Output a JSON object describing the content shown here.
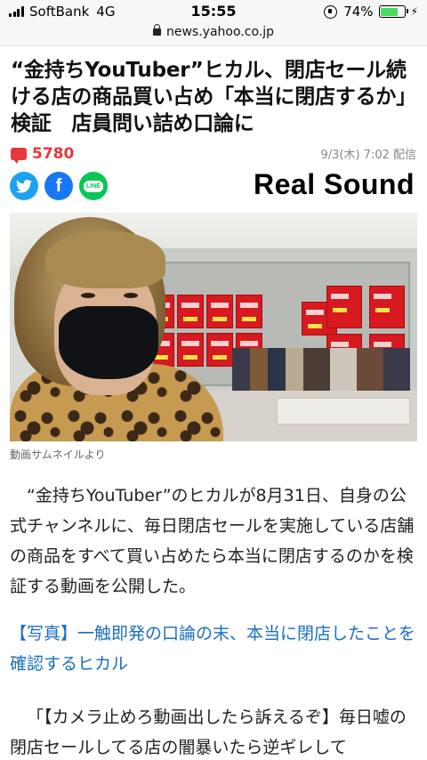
{
  "status_bar": {
    "carrier": "SoftBank",
    "network": "4G",
    "time": "15:55",
    "battery": "74%",
    "battery_level": 0.74
  },
  "url_bar": {
    "url": "news.yahoo.co.jp"
  },
  "article": {
    "headline": "“金持ちYouTuber”ヒカル、閉店セール続ける店の商品買い占め「本当に閉店するか」検証　店員問い詰め口論に",
    "comment_count": "5780",
    "date": "9/3(木) 7:02 配信",
    "publisher": "Real Sound",
    "share": {
      "twitter_icon": "twitter-icon",
      "facebook_icon": "facebook-icon",
      "line_label": "LINE"
    },
    "image_caption": "動画サムネイルより",
    "paragraph_1": "“金持ちYouTuber”のヒカルが8月31日、自身の公式チャンネルに、毎日閉店セールを実施している店舗の商品をすべて買い占めたら本当に閉店するのかを検証する動画を公開した。",
    "photo_link": "【写真】一触即発の口論の末、本当に閉店したことを確認するヒカル",
    "paragraph_2": "「【カメラ止めろ動画出したら訴えるぞ】毎日嘘の閉店セールしてる店の闇暴いたら逆ギレして"
  },
  "colors": {
    "accent_red": "#e5383b",
    "link_blue": "#1a6fc2",
    "twitter": "#1da1f2",
    "facebook": "#1877f2",
    "line": "#06c755"
  }
}
